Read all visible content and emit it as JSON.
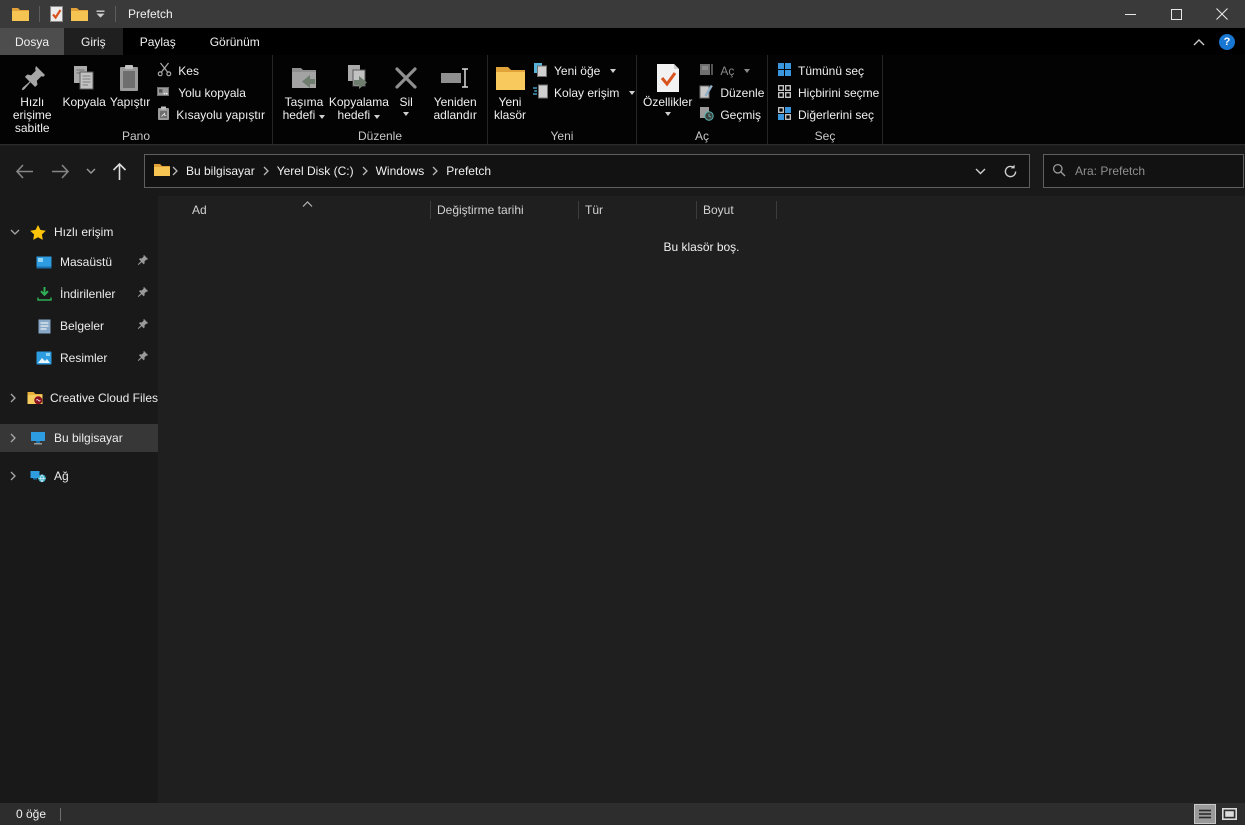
{
  "window": {
    "title": "Prefetch"
  },
  "tabs": {
    "file": "Dosya",
    "home": "Giriş",
    "share": "Paylaş",
    "view": "Görünüm",
    "help_label": "?"
  },
  "ribbon": {
    "pin_to_quick_access": "Hızlı erişime sabitle",
    "copy": "Kopyala",
    "paste": "Yapıştır",
    "cut": "Kes",
    "copy_path": "Yolu kopyala",
    "paste_shortcut": "Kısayolu yapıştır",
    "group_clipboard": "Pano",
    "move_to": "Taşıma hedefi",
    "copy_to": "Kopyalama hedefi",
    "delete": "Sil",
    "rename": "Yeniden adlandır",
    "group_organize": "Düzenle",
    "new_folder": "Yeni klasör",
    "new_item": "Yeni öğe",
    "easy_access": "Kolay erişim",
    "group_new": "Yeni",
    "properties": "Özellikler",
    "open": "Aç",
    "edit": "Düzenle",
    "history": "Geçmiş",
    "group_open": "Aç",
    "select_all": "Tümünü seç",
    "select_none": "Hiçbirini seçme",
    "invert_selection": "Diğerlerini seç",
    "group_select": "Seç"
  },
  "navbar": {
    "crumbs": [
      "Bu bilgisayar",
      "Yerel Disk (C:)",
      "Windows",
      "Prefetch"
    ],
    "search_placeholder": "Ara: Prefetch"
  },
  "sidebar": {
    "quick_access": "Hızlı erişim",
    "desktop": "Masaüstü",
    "downloads": "İndirilenler",
    "documents": "Belgeler",
    "pictures": "Resimler",
    "creative_cloud": "Creative Cloud Files",
    "this_pc": "Bu bilgisayar",
    "network": "Ağ"
  },
  "main": {
    "columns": {
      "name": "Ad",
      "date_modified": "Değiştirme tarihi",
      "type": "Tür",
      "size": "Boyut"
    },
    "empty_message": "Bu klasör boş."
  },
  "statusbar": {
    "item_count": "0 öğe"
  },
  "colors": {
    "accent_blue": "#3a96dd",
    "folder_yellow": "#f6c452",
    "properties_check": "#d9531e"
  }
}
